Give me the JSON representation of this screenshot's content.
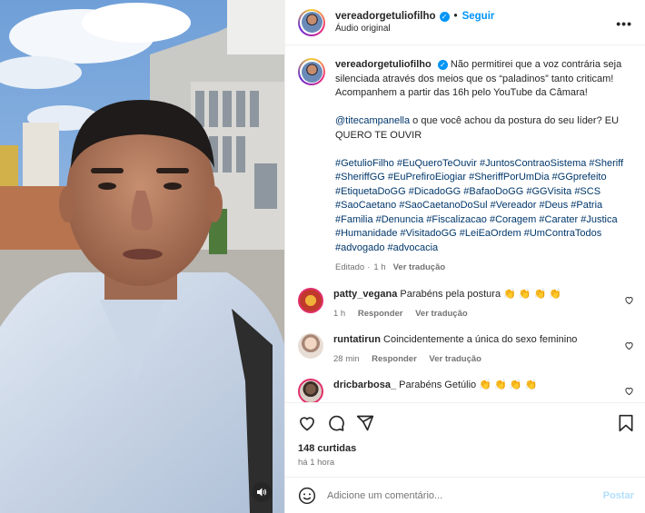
{
  "header": {
    "username": "vereadorgetuliofilho",
    "follow_label": "Seguir",
    "subtitle": "Áudio original",
    "more_label": "•••"
  },
  "caption": {
    "username": "vereadorgetuliofilho",
    "text": "Não permitirei que a voz contrária seja silenciada através dos meios que os “paladinos” tanto criticam! Acompanhem a partir das 16h pelo YouTube da Câmara!",
    "mention": "@titecampanella",
    "mention_text": " o que você achou da postura do seu líder? EU QUERO TE OUVIR",
    "hashtags": "#GetulioFilho #EuQueroTeOuvir #JuntosContraoSistema #Sheriff #SheriffGG #EuPrefiroEiogiar #SheriffPorUmDia #GGprefeito #EtiquetaDoGG #DicadoGG #BafaoDoGG #GGVisita #SCS #SaoCaetano #SaoCaetanoDoSul #Vereador #Deus #Patria #Familia #Denuncia #Fiscalizacao #Coragem #Carater #Justica #Humanidade #VisitadoGG #LeiEaOrdem #UmContraTodos #advogado #advocacia",
    "edited": "Editado",
    "time": "1 h",
    "see_translation": "Ver tradução"
  },
  "comments": [
    {
      "username": "patty_vegana",
      "text": "Parabéns pela postura 👏 👏 👏 👏",
      "time": "1 h",
      "reply": "Responder",
      "translate": "Ver tradução",
      "avatar_color": "#c0392b"
    },
    {
      "username": "runtatirun",
      "text": "Coincidentemente a única do sexo feminino",
      "time": "28 min",
      "reply": "Responder",
      "translate": "Ver tradução",
      "avatar_color": "#d9c3b0"
    },
    {
      "username": "dricbarbosa_",
      "text": "Parabéns Getúlio 👏 👏 👏 👏",
      "time": "",
      "reply": "",
      "translate": "",
      "avatar_color": "#5b4a3c"
    }
  ],
  "actions": {
    "likes": "148 curtidas",
    "time": "há 1 hora"
  },
  "add_comment": {
    "placeholder": "Adicione um comentário...",
    "post_label": "Postar"
  },
  "colors": {
    "accent": "#0095f6",
    "hashtag": "#00376b",
    "muted": "#737373"
  },
  "icons": [
    "verified-icon",
    "more-icon",
    "heart-icon",
    "comment-icon",
    "share-icon",
    "save-icon",
    "emoji-icon",
    "audio-icon"
  ]
}
